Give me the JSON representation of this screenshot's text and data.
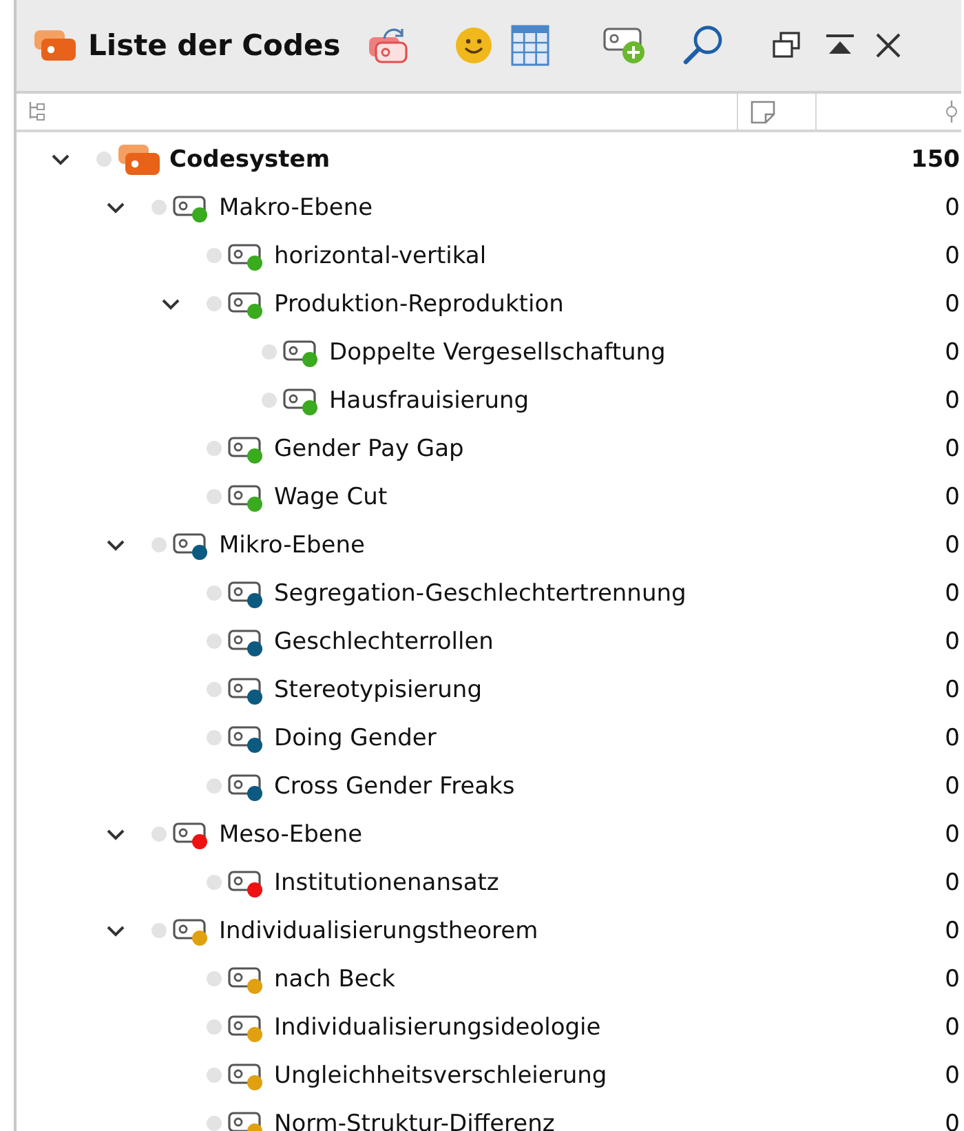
{
  "panel": {
    "title": "Liste der Codes"
  },
  "tree": [
    {
      "label": "Codesystem",
      "kind": "root",
      "count": "150",
      "expanded": true,
      "children": [
        {
          "label": "Makro-Ebene",
          "kind": "code",
          "color": "#3aaa1e",
          "count": "0",
          "expanded": true,
          "children": [
            {
              "label": "horizontal-vertikal",
              "kind": "code",
              "color": "#3aaa1e",
              "count": "0"
            },
            {
              "label": "Produktion-Reproduktion",
              "kind": "code",
              "color": "#3aaa1e",
              "count": "0",
              "expanded": true,
              "children": [
                {
                  "label": "Doppelte Vergesellschaftung",
                  "kind": "code",
                  "color": "#3aaa1e",
                  "count": "0"
                },
                {
                  "label": "Hausfrauisierung",
                  "kind": "code",
                  "color": "#3aaa1e",
                  "count": "0"
                }
              ]
            },
            {
              "label": "Gender Pay Gap",
              "kind": "code",
              "color": "#3aaa1e",
              "count": "0"
            },
            {
              "label": "Wage Cut",
              "kind": "code",
              "color": "#3aaa1e",
              "count": "0"
            }
          ]
        },
        {
          "label": "Mikro-Ebene",
          "kind": "code",
          "color": "#0d5a80",
          "count": "0",
          "expanded": true,
          "children": [
            {
              "label": "Segregation-Geschlechtertrennung",
              "kind": "code",
              "color": "#0d5a80",
              "count": "0"
            },
            {
              "label": "Geschlechterrollen",
              "kind": "code",
              "color": "#0d5a80",
              "count": "0"
            },
            {
              "label": "Stereotypisierung",
              "kind": "code",
              "color": "#0d5a80",
              "count": "0"
            },
            {
              "label": "Doing Gender",
              "kind": "code",
              "color": "#0d5a80",
              "count": "0"
            },
            {
              "label": "Cross Gender Freaks",
              "kind": "code",
              "color": "#0d5a80",
              "count": "0"
            }
          ]
        },
        {
          "label": "Meso-Ebene",
          "kind": "code",
          "color": "#ee1111",
          "count": "0",
          "expanded": true,
          "children": [
            {
              "label": "Institutionenansatz",
              "kind": "code",
              "color": "#ee1111",
              "count": "0"
            }
          ]
        },
        {
          "label": "Individualisierungstheorem",
          "kind": "code",
          "color": "#e0a010",
          "count": "0",
          "expanded": true,
          "children": [
            {
              "label": "nach Beck",
              "kind": "code",
              "color": "#e0a010",
              "count": "0"
            },
            {
              "label": "Individualisierungsideologie",
              "kind": "code",
              "color": "#e0a010",
              "count": "0"
            },
            {
              "label": "Ungleichheitsverschleierung",
              "kind": "code",
              "color": "#e0a010",
              "count": "0"
            },
            {
              "label": "Norm-Struktur-Differenz",
              "kind": "code",
              "color": "#e0a010",
              "count": "0"
            }
          ]
        }
      ]
    }
  ]
}
